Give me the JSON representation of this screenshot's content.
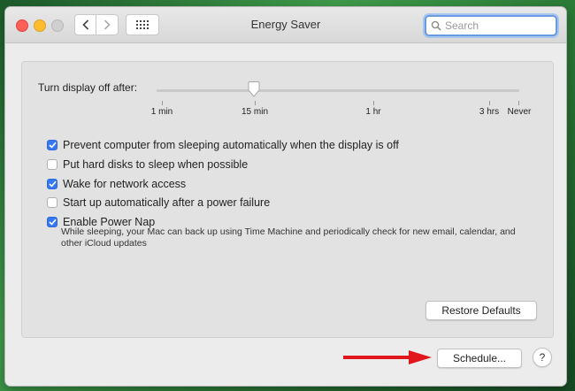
{
  "window": {
    "title": "Energy Saver"
  },
  "search": {
    "placeholder": "Search"
  },
  "icons": {
    "back": "chevron-left-icon",
    "forward": "chevron-right-icon",
    "grid": "grid-icon",
    "search": "magnifier-icon",
    "check": "checkmark-icon",
    "arrow": "red-arrow-icon"
  },
  "colors": {
    "accent": "#3478f6",
    "arrow": "#e0161c",
    "search_focus": "#6a9be0"
  },
  "display_off": {
    "label": "Turn display off after:",
    "ticks": [
      "1 min",
      "15 min",
      "1 hr",
      "3 hrs",
      "Never"
    ],
    "selected": "15 min"
  },
  "options": [
    {
      "label": "Prevent computer from sleeping automatically when the display is off",
      "checked": true
    },
    {
      "label": "Put hard disks to sleep when possible",
      "checked": false
    },
    {
      "label": "Wake for network access",
      "checked": true
    },
    {
      "label": "Start up automatically after a power failure",
      "checked": false
    },
    {
      "label": "Enable Power Nap",
      "checked": true
    }
  ],
  "power_nap_description": "While sleeping, your Mac can back up using Time Machine and periodically check for new email, calendar, and other iCloud updates",
  "buttons": {
    "restore_defaults": "Restore Defaults",
    "schedule": "Schedule...",
    "help": "?"
  }
}
